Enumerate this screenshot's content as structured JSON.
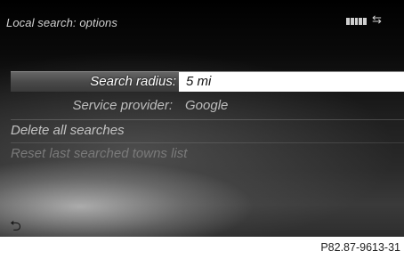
{
  "header": {
    "title": "Local search: options",
    "signal_icon": "signal-strength-icon",
    "arrows_glyph": "⇆"
  },
  "settings": {
    "radius_label": "Search radius:",
    "radius_value": "5 mi",
    "provider_label": "Service provider:",
    "provider_value": "Google"
  },
  "menu": {
    "delete_label": "Delete all searches",
    "reset_label": "Reset last searched towns list"
  },
  "footer": {
    "back_glyph": "⮌",
    "figure_code": "P82.87-9613-31"
  }
}
